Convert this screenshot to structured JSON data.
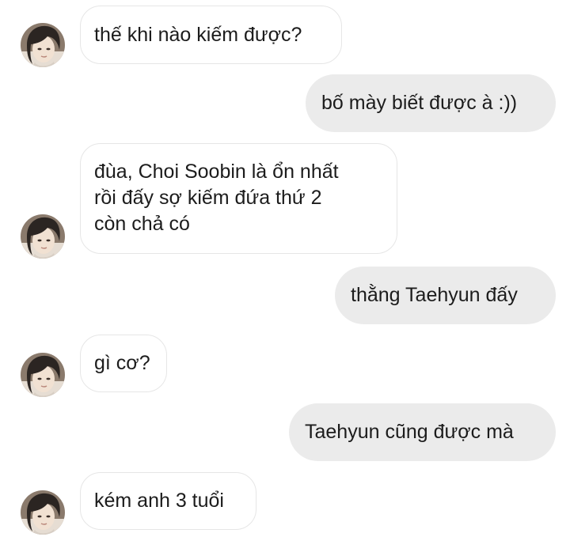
{
  "conversation": {
    "messages": [
      {
        "side": "received",
        "text": "thế khi nào kiếm được?"
      },
      {
        "side": "sent",
        "text": "bố mày biết được à :))"
      },
      {
        "side": "received",
        "lines": [
          "đùa, Choi Soobin là ổn nhất",
          "rồi đấy sợ kiếm đứa thứ 2",
          "còn chả có"
        ]
      },
      {
        "side": "sent",
        "text": "thằng Taehyun đấy"
      },
      {
        "side": "received",
        "text": "gì cơ?"
      },
      {
        "side": "sent",
        "text": "Taehyun cũng được mà"
      },
      {
        "side": "received",
        "text": "kém anh 3 tuổi"
      }
    ]
  },
  "colors": {
    "sent_bubble": "#ebebeb",
    "received_bubble": "#ffffff",
    "received_border": "#e6e6e6",
    "text": "#1c1c1c"
  },
  "icons": {
    "avatar": "contact-avatar-photo"
  }
}
